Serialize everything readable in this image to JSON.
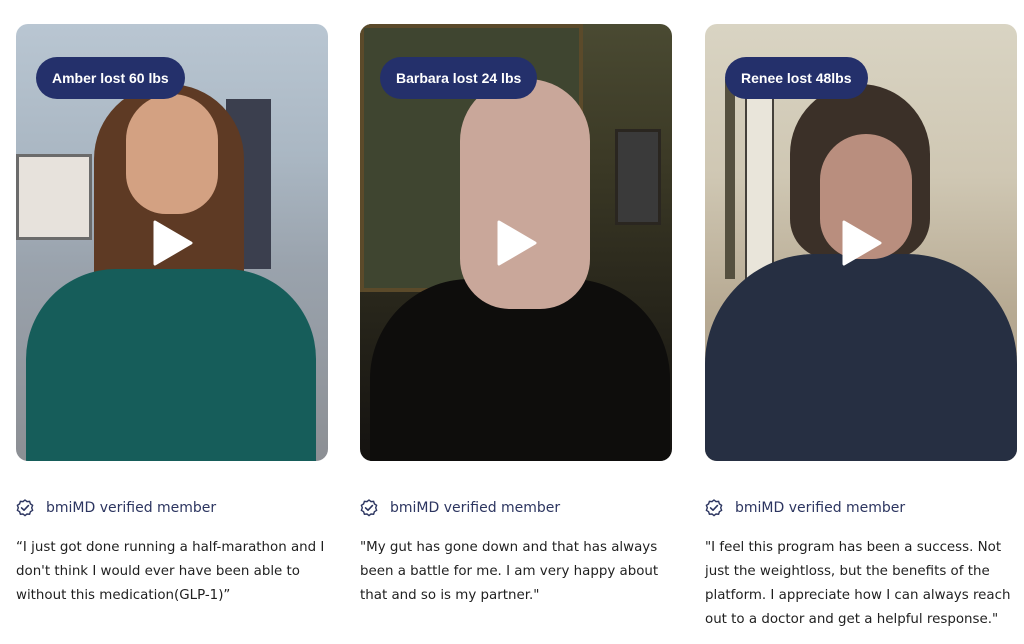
{
  "testimonials": [
    {
      "badge": "Amber lost 60 lbs",
      "verified_label": "bmiMD verified member",
      "quote": "“I just got done running a half-marathon and I don't think I would ever have been able to without this medication(GLP-1)”"
    },
    {
      "badge": "Barbara lost 24 lbs",
      "verified_label": "bmiMD verified member",
      "quote": "\"My gut has gone down and that has always been a battle for me. I am very happy about that and so is my partner.\""
    },
    {
      "badge": "Renee lost 48lbs",
      "verified_label": "bmiMD verified member",
      "quote": "\"I feel this program has been a success. Not just the weightloss, but the benefits of the platform. I appreciate how I can always reach out to a doctor and get a helpful response.\""
    }
  ],
  "colors": {
    "badge_bg": "#24306b",
    "verified_text": "#2c3560"
  },
  "icons": {
    "play": "play-icon",
    "verified": "verified-check-icon"
  }
}
